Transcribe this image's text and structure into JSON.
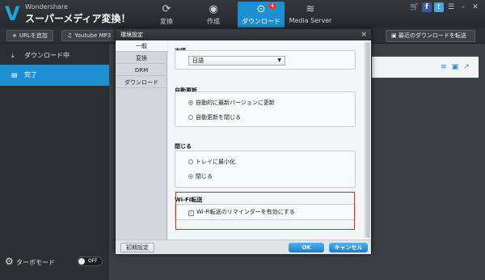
{
  "app": {
    "brand_small": "Wondershare",
    "brand_title": "スーパーメディア変換！"
  },
  "nav": {
    "tabs": [
      {
        "label": "変換",
        "icon": "refresh-icon"
      },
      {
        "label": "作成",
        "icon": "disc-icon"
      },
      {
        "label": "ダウンロード",
        "icon": "download-icon",
        "badge": "4"
      },
      {
        "label": "Media Server",
        "icon": "wifi-icon"
      }
    ]
  },
  "toolbar": {
    "add_url": "URLを追加",
    "youtube_mp3": "Youtube MP3",
    "transfer_latest": "最近のダウンロードを転送"
  },
  "sidebar": {
    "items": [
      {
        "label": "ダウンロード中",
        "icon": "download-icon"
      },
      {
        "label": "完了",
        "icon": "document-icon"
      }
    ],
    "turbo_label": "ターボモード",
    "turbo_state": "OFF"
  },
  "dialog": {
    "title": "環境設定",
    "close": "×",
    "tabs": [
      "一般",
      "変換",
      "DRM",
      "ダウンロード"
    ],
    "language_title": "言語",
    "language_value": "日語",
    "update_title": "自動更新",
    "update_options": [
      "自動的に最新バージョンに更新",
      "自動更新を閉じる"
    ],
    "close_title": "閉じる",
    "close_options": [
      "トレイに最小化",
      "閉じる"
    ],
    "wifi_title": "Wi-Fi転送",
    "wifi_option": "Wi-Fi転送のリマインダーを有効にする",
    "reset": "初期設定",
    "ok": "OK",
    "cancel": "キャンセル"
  },
  "colors": {
    "accent": "#1e8fd1",
    "highlight_border": "#d8282a"
  }
}
